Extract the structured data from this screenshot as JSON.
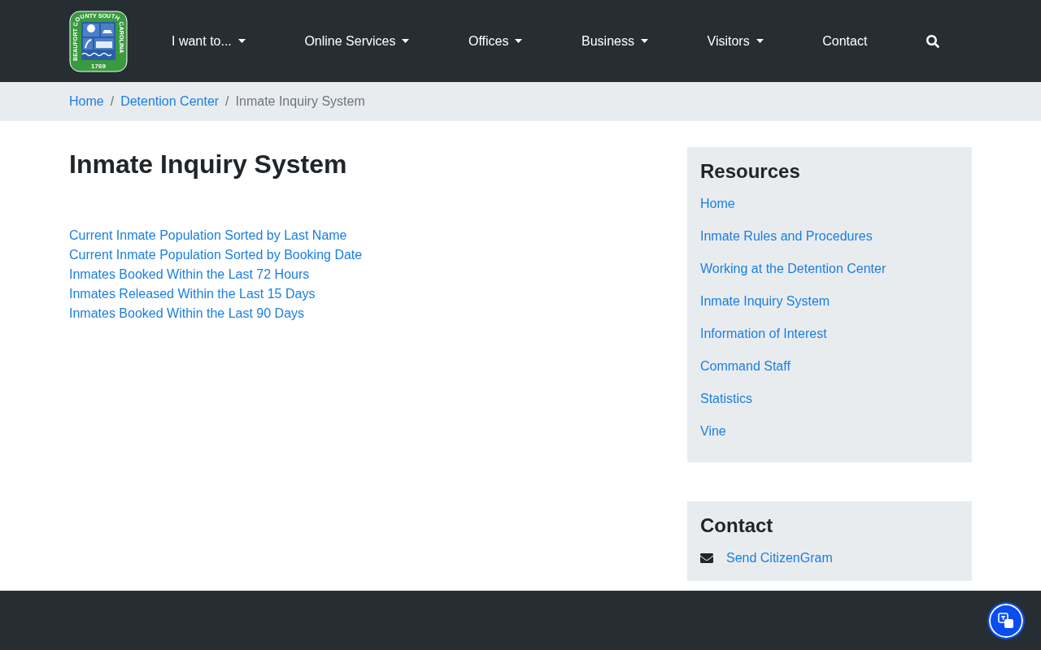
{
  "logo": {
    "arc_text": "BEAUFORT COUNTY SOUTH CAROLINA",
    "year": "1769"
  },
  "nav": [
    {
      "label": "I want to...",
      "dropdown": true
    },
    {
      "label": "Online Services",
      "dropdown": true
    },
    {
      "label": "Offices",
      "dropdown": true
    },
    {
      "label": "Business",
      "dropdown": true
    },
    {
      "label": "Visitors",
      "dropdown": true
    },
    {
      "label": "Contact",
      "dropdown": false
    }
  ],
  "breadcrumb": [
    {
      "label": "Home",
      "link": true
    },
    {
      "label": "Detention Center",
      "link": true
    },
    {
      "label": "Inmate Inquiry System",
      "link": false
    }
  ],
  "breadcrumb_separator": "/",
  "page_title": "Inmate Inquiry System",
  "links": [
    "Current Inmate Population Sorted by Last Name",
    "Current Inmate Population Sorted by Booking Date",
    "Inmates Booked Within the Last 72 Hours",
    "Inmates Released Within the Last 15 Days",
    "Inmates Booked Within the Last 90 Days"
  ],
  "resources": {
    "title": "Resources",
    "items": [
      "Home",
      "Inmate Rules and Procedures",
      "Working at the Detention Center",
      "Inmate Inquiry System",
      "Information of Interest",
      "Command Staff",
      "Statistics",
      "Vine"
    ]
  },
  "contact": {
    "title": "Contact",
    "link": "Send CitizenGram"
  }
}
